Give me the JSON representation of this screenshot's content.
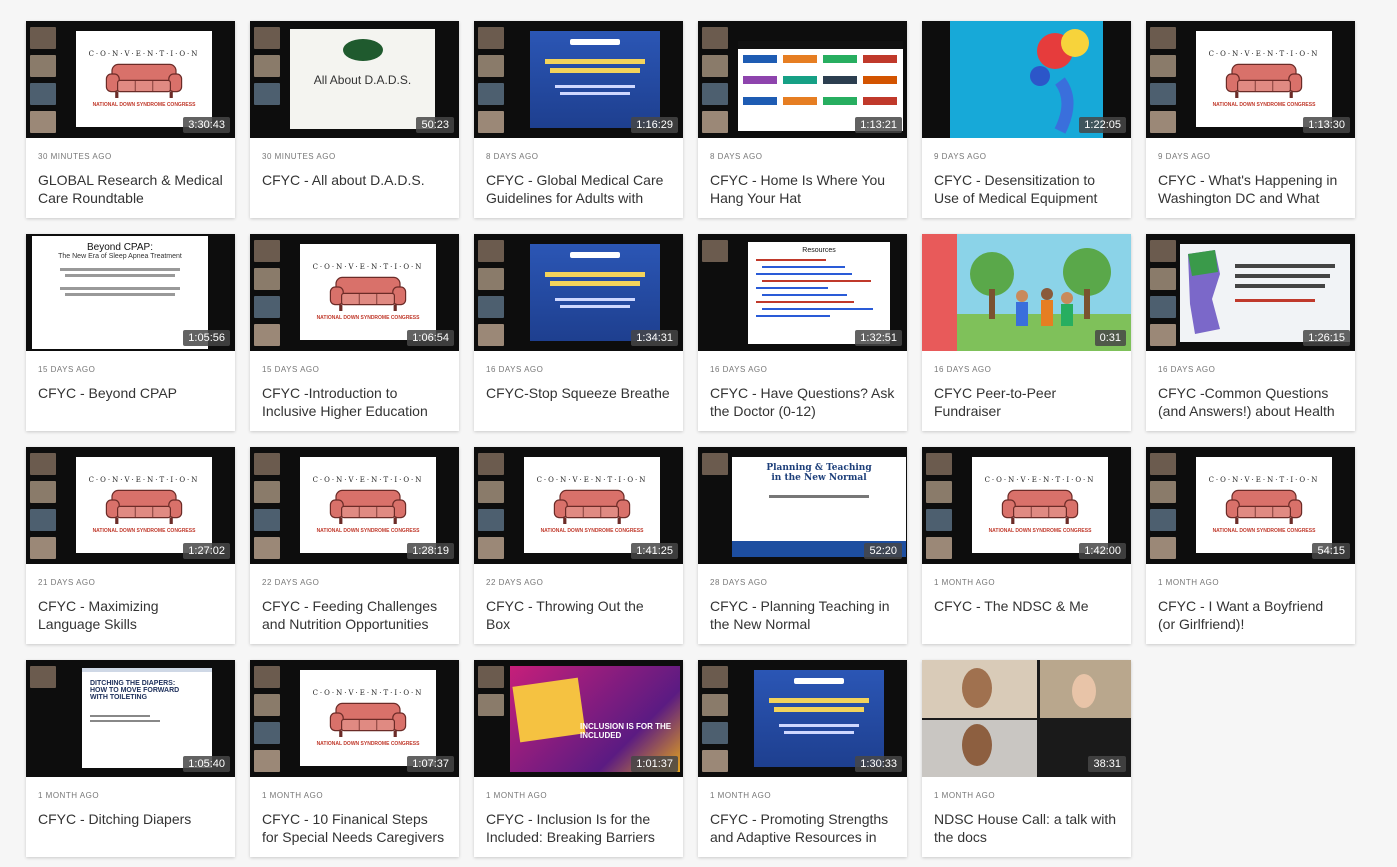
{
  "videos": [
    {
      "age": "30 MINUTES AGO",
      "title": "GLOBAL Research & Medical Care Roundtable",
      "duration": "3:30:43",
      "thumb": "couch"
    },
    {
      "age": "30 MINUTES AGO",
      "title": "CFYC - All about D.A.D.S.",
      "duration": "50:23",
      "thumb": "dads"
    },
    {
      "age": "8 DAYS AGO",
      "title": "CFYC - Global Medical Care Guidelines for Adults with",
      "duration": "1:16:29",
      "thumb": "blue"
    },
    {
      "age": "8 DAYS AGO",
      "title": "CFYC - Home Is Where You Hang Your Hat",
      "duration": "1:13:21",
      "thumb": "sponsors"
    },
    {
      "age": "9 DAYS AGO",
      "title": "CFYC - Desensitization to Use of Medical Equipment",
      "duration": "1:22:05",
      "thumb": "desens"
    },
    {
      "age": "9 DAYS AGO",
      "title": "CFYC - What's Happening in Washington DC and What",
      "duration": "1:13:30",
      "thumb": "couch"
    },
    {
      "age": "15 DAYS AGO",
      "title": "CFYC - Beyond CPAP",
      "duration": "1:05:56",
      "thumb": "cpap"
    },
    {
      "age": "15 DAYS AGO",
      "title": "CFYC -Introduction to Inclusive Higher Education",
      "duration": "1:06:54",
      "thumb": "couch"
    },
    {
      "age": "16 DAYS AGO",
      "title": "CFYC-Stop Squeeze Breathe",
      "duration": "1:34:31",
      "thumb": "blue"
    },
    {
      "age": "16 DAYS AGO",
      "title": "CFYC - Have Questions? Ask the Doctor (0-12)",
      "duration": "1:32:51",
      "thumb": "resources"
    },
    {
      "age": "16 DAYS AGO",
      "title": "CFYC Peer-to-Peer Fundraiser",
      "duration": "0:31",
      "thumb": "park"
    },
    {
      "age": "16 DAYS AGO",
      "title": "CFYC -Common Questions (and Answers!) about Health",
      "duration": "1:26:15",
      "thumb": "map"
    },
    {
      "age": "21 DAYS AGO",
      "title": "CFYC - Maximizing Language Skills",
      "duration": "1:27:02",
      "thumb": "couch"
    },
    {
      "age": "22 DAYS AGO",
      "title": "CFYC - Feeding Challenges and Nutrition Opportunities",
      "duration": "1:28:19",
      "thumb": "couch"
    },
    {
      "age": "22 DAYS AGO",
      "title": "CFYC - Throwing Out the Box",
      "duration": "1:41:25",
      "thumb": "couch"
    },
    {
      "age": "28 DAYS AGO",
      "title": "CFYC - Planning Teaching in the New Normal",
      "duration": "52:20",
      "thumb": "planning"
    },
    {
      "age": "1 MONTH AGO",
      "title": "CFYC - The NDSC & Me",
      "duration": "1:42:00",
      "thumb": "couch"
    },
    {
      "age": "1 MONTH AGO",
      "title": "CFYC - I Want a Boyfriend (or Girlfriend)!",
      "duration": "54:15",
      "thumb": "couch"
    },
    {
      "age": "1 MONTH AGO",
      "title": "CFYC - Ditching Diapers",
      "duration": "1:05:40",
      "thumb": "diapers"
    },
    {
      "age": "1 MONTH AGO",
      "title": "CFYC - 10 Finanical Steps for Special Needs Caregivers",
      "duration": "1:07:37",
      "thumb": "couch"
    },
    {
      "age": "1 MONTH AGO",
      "title": "CFYC - Inclusion Is for the Included: Breaking Barriers",
      "duration": "1:01:37",
      "thumb": "countdown"
    },
    {
      "age": "1 MONTH AGO",
      "title": "CFYC - Promoting Strengths and Adaptive Resources in",
      "duration": "1:30:33",
      "thumb": "blue"
    },
    {
      "age": "1 MONTH AGO",
      "title": "NDSC House Call: a talk with the docs",
      "duration": "38:31",
      "thumb": "faces"
    }
  ]
}
